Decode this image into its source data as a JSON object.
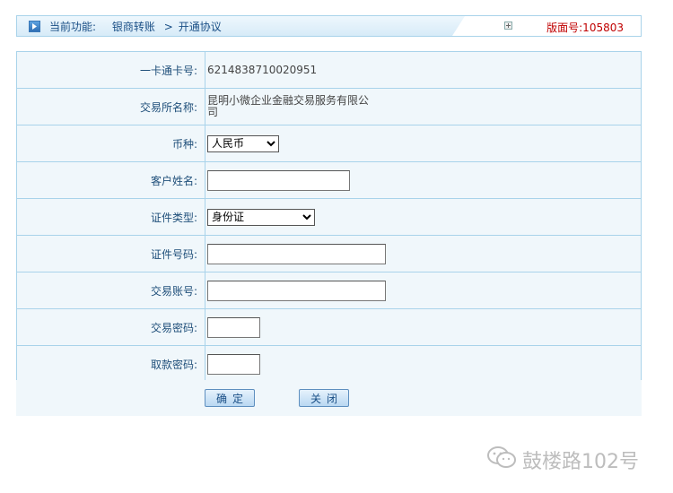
{
  "header": {
    "breadcrumb_title": "当前功能:",
    "breadcrumb_section": "银商转账",
    "breadcrumb_page": "开通协议",
    "breadcrumb_sep": ">",
    "version_label": "版面号:105803"
  },
  "form": {
    "card_no_label": "一卡通卡号:",
    "card_no_value": "6214838710020951",
    "exchange_name_label": "交易所名称:",
    "exchange_name_value": "昆明小微企业金融交易服务有限公司",
    "currency_label": "币种:",
    "currency_value": "人民币",
    "customer_name_label": "客户姓名:",
    "customer_name_value": "",
    "id_type_label": "证件类型:",
    "id_type_value": "身份证",
    "id_no_label": "证件号码:",
    "id_no_value": "",
    "trade_account_label": "交易账号:",
    "trade_account_value": "",
    "trade_password_label": "交易密码:",
    "trade_password_value": "",
    "withdraw_password_label": "取款密码:",
    "withdraw_password_value": ""
  },
  "buttons": {
    "confirm_label": "确定",
    "close_label": "关闭"
  },
  "watermark": {
    "text": "鼓楼路102号"
  },
  "colors": {
    "border": "#a9d3ea",
    "row_bg": "#f0f7fb",
    "label_text": "#1f4f7a",
    "version_text": "#c00000"
  }
}
